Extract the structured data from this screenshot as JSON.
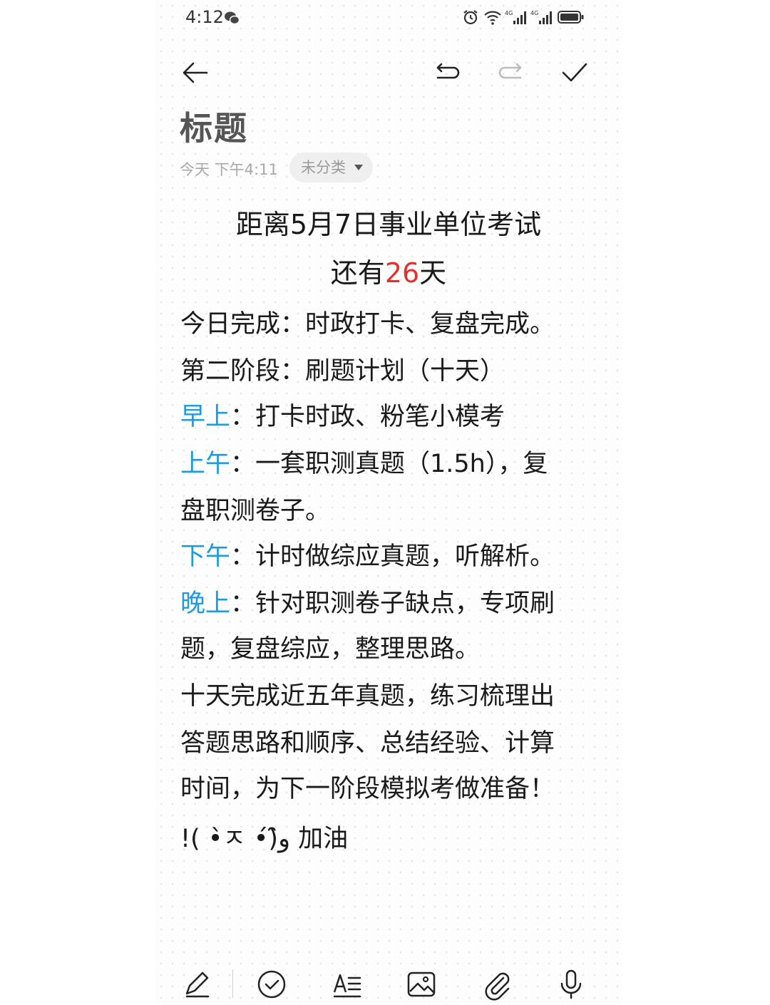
{
  "status_bar": {
    "time": "4:12"
  },
  "toolbar": {
    "back": "back-arrow-icon",
    "undo": "undo-icon",
    "redo": "redo-icon",
    "done": "check-icon"
  },
  "note": {
    "title": "标题",
    "date": "今天 下午4:11",
    "category": "未分类"
  },
  "content": {
    "headline1": "距离5月7日事业单位考试",
    "headline2_prefix": "还有",
    "headline2_days": "26",
    "headline2_suffix": "天",
    "line_today": "今日完成：时政打卡、复盘完成。",
    "line_phase": "第二阶段：刷题计划（十天）",
    "morning_label": "早上",
    "morning_text": "：打卡时政、粉笔小模考",
    "forenoon_label": "上午",
    "forenoon_text1": "：一套职测真题（1.5h），复",
    "forenoon_text2": "盘职测卷子。",
    "afternoon_label": "下午",
    "afternoon_text": "：计时做综应真题，听解析。",
    "evening_label": "晚上",
    "evening_text1": "：针对职测卷子缺点，专项刷",
    "evening_text2": "题，复盘综应，整理思路。",
    "summary1": "十天完成近五年真题，练习梳理出",
    "summary2": "答题思路和顺序、总结经验、计算",
    "summary3": "时间，为下一阶段模拟考做准备！",
    "cheer": "!( •̀ㅈ •́)و̑̑ 加油"
  },
  "colors": {
    "label_blue": "#1e9be0",
    "highlight_red": "#e0312f"
  }
}
